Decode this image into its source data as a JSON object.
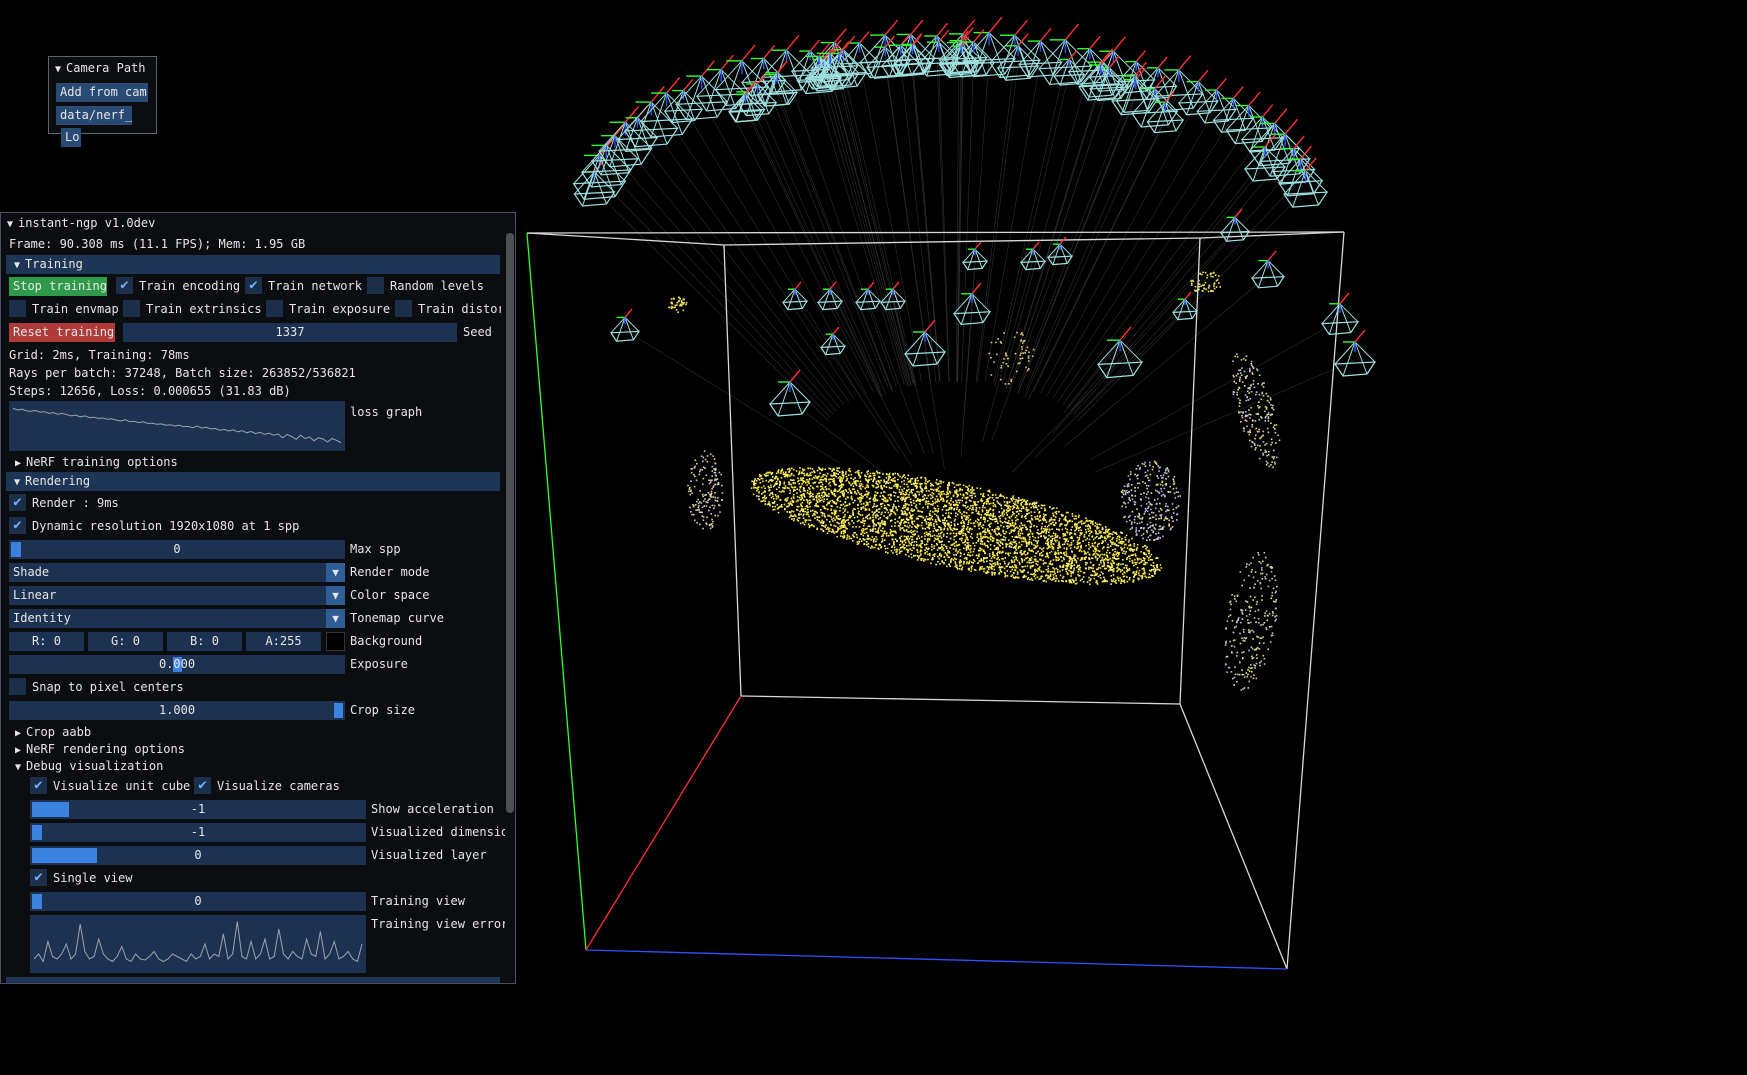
{
  "colors": {
    "panel_bg": "#0b0d10",
    "header_bg": "#1e3655",
    "field_bg": "#1c3250",
    "accent": "#3c82e0",
    "stop_button": "#2f9a4a",
    "reset_button": "#b03a3a",
    "cube_edge": "#d8d8d8",
    "axis_x": "#ff3030",
    "axis_y": "#30ff30",
    "axis_z": "#3050ff",
    "camera_frustum": "#9fe0e0",
    "point_cloud": "#ffee33"
  },
  "camera_path": {
    "title": "Camera Path",
    "add_from_cam": "Add from cam",
    "path_field": "data/nerf_",
    "load_button": "Lo"
  },
  "window": {
    "title": "instant-ngp v1.0dev"
  },
  "frame_stats": "Frame: 90.308 ms (11.1 FPS); Mem: 1.95 GB",
  "training": {
    "header": "Training",
    "stop_training": "Stop training",
    "train_encoding": "Train encoding",
    "train_network": "Train network",
    "random_levels": "Random levels",
    "train_envmap": "Train envmap",
    "train_extrinsics": "Train extrinsics",
    "train_exposure": "Train exposure",
    "train_distortion": "Train distor",
    "reset_training": "Reset training",
    "seed_value": "1337",
    "seed_label": "Seed",
    "timing": "Grid: 2ms, Training: 78ms",
    "rays": "Rays per batch: 37248, Batch size: 263852/536821",
    "steps": "Steps: 12656, Loss: 0.000655 (31.83 dB)",
    "loss_graph_label": "loss graph",
    "nerf_training_options": "NeRF training options",
    "loss_graph": [
      0.92,
      0.88,
      0.9,
      0.86,
      0.85,
      0.87,
      0.83,
      0.84,
      0.8,
      0.82,
      0.78,
      0.8,
      0.77,
      0.74,
      0.76,
      0.72,
      0.74,
      0.7,
      0.71,
      0.68,
      0.69,
      0.66,
      0.67,
      0.64,
      0.62,
      0.65,
      0.6,
      0.61,
      0.58,
      0.6,
      0.56,
      0.57,
      0.54,
      0.55,
      0.52,
      0.53,
      0.5,
      0.52,
      0.48,
      0.49,
      0.46,
      0.5,
      0.45,
      0.47,
      0.43,
      0.44,
      0.4,
      0.42,
      0.38,
      0.41,
      0.36,
      0.39,
      0.34,
      0.37,
      0.32,
      0.35,
      0.3,
      0.33,
      0.28,
      0.31,
      0.22,
      0.3,
      0.25,
      0.18,
      0.28,
      0.2,
      0.24,
      0.15,
      0.22,
      0.19,
      0.12,
      0.2,
      0.16,
      0.1
    ]
  },
  "rendering": {
    "header": "Rendering",
    "render": "Render : 9ms",
    "dynamic_resolution": "Dynamic resolution 1920x1080 at 1 spp",
    "max_spp_value": "0",
    "max_spp_label": "Max spp",
    "render_mode_value": "Shade",
    "render_mode_label": "Render mode",
    "color_space_value": "Linear",
    "color_space_label": "Color space",
    "tonemap_value": "Identity",
    "tonemap_label": "Tonemap curve",
    "bg_r": "R:  0",
    "bg_g": "G:  0",
    "bg_b": "B:  0",
    "bg_a": "A:255",
    "background_label": "Background",
    "exposure_value": "0.000",
    "exposure_label": "Exposure",
    "snap_pixel": "Snap to pixel centers",
    "crop_value": "1.000",
    "crop_label": "Crop size",
    "crop_aabb": "Crop aabb",
    "nerf_rendering_options": "NeRF rendering options",
    "debug_visualization": "Debug visualization",
    "visualize_unit_cube": "Visualize unit cube",
    "visualize_cameras": "Visualize cameras",
    "show_accel_value": "-1",
    "show_accel_label": "Show acceleration",
    "vis_dim_value": "-1",
    "vis_dim_label": "Visualized dimensio",
    "vis_layer_value": "0",
    "vis_layer_label": "Visualized layer",
    "single_view": "Single view",
    "training_view_value": "0",
    "training_view_label": "Training view",
    "training_view_error_label": "Training view error",
    "error_graph": [
      0.2,
      0.3,
      0.15,
      0.55,
      0.25,
      0.2,
      0.3,
      0.5,
      0.2,
      0.3,
      0.9,
      0.35,
      0.2,
      0.25,
      0.6,
      0.3,
      0.2,
      0.15,
      0.25,
      0.45,
      0.2,
      0.15,
      0.3,
      0.2,
      0.18,
      0.25,
      0.35,
      0.2,
      0.15,
      0.2,
      0.3,
      0.25,
      0.2,
      0.15,
      0.3,
      0.2,
      0.25,
      0.5,
      0.2,
      0.3,
      0.25,
      0.7,
      0.2,
      0.3,
      0.95,
      0.25,
      0.2,
      0.55,
      0.2,
      0.3,
      0.6,
      0.2,
      0.25,
      0.8,
      0.3,
      0.2,
      0.35,
      0.25,
      0.2,
      0.6,
      0.3,
      0.25,
      0.75,
      0.2,
      0.3,
      0.55,
      0.2,
      0.25,
      0.35,
      0.2,
      0.15,
      0.5
    ]
  }
}
